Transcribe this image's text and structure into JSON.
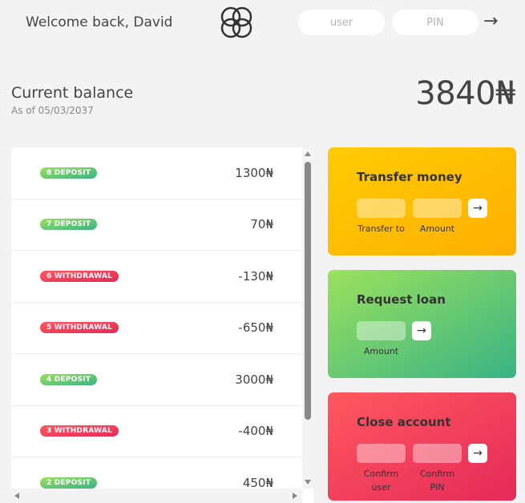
{
  "nav": {
    "welcome": "Welcome back, David",
    "user_placeholder": "user",
    "pin_placeholder": "PIN",
    "login_button": "→"
  },
  "balance": {
    "label": "Current balance",
    "date": "As of 05/03/2037",
    "value": "3840₦"
  },
  "movements": [
    {
      "type_label": "8 DEPOSIT",
      "type": "deposit",
      "value": "1300₦"
    },
    {
      "type_label": "7 DEPOSIT",
      "type": "deposit",
      "value": "70₦"
    },
    {
      "type_label": "6 WITHDRAWAL",
      "type": "withdrawal",
      "value": "-130₦"
    },
    {
      "type_label": "5 WITHDRAWAL",
      "type": "withdrawal",
      "value": "-650₦"
    },
    {
      "type_label": "4 DEPOSIT",
      "type": "deposit",
      "value": "3000₦"
    },
    {
      "type_label": "3 WITHDRAWAL",
      "type": "withdrawal",
      "value": "-400₦"
    },
    {
      "type_label": "2 DEPOSIT",
      "type": "deposit",
      "value": "450₦"
    }
  ],
  "operations": {
    "transfer": {
      "title": "Transfer money",
      "button": "→",
      "label_to": "Transfer to",
      "label_amount": "Amount"
    },
    "loan": {
      "title": "Request loan",
      "button": "→",
      "label_amount": "Amount"
    },
    "close": {
      "title": "Close account",
      "button": "→",
      "label_user": "Confirm user",
      "label_pin": "Confirm PIN"
    }
  },
  "colors": {
    "deposit": "#39b385",
    "withdrawal": "#e52a5a",
    "transfer": "#ffb003",
    "background": "#f3f3f3"
  }
}
